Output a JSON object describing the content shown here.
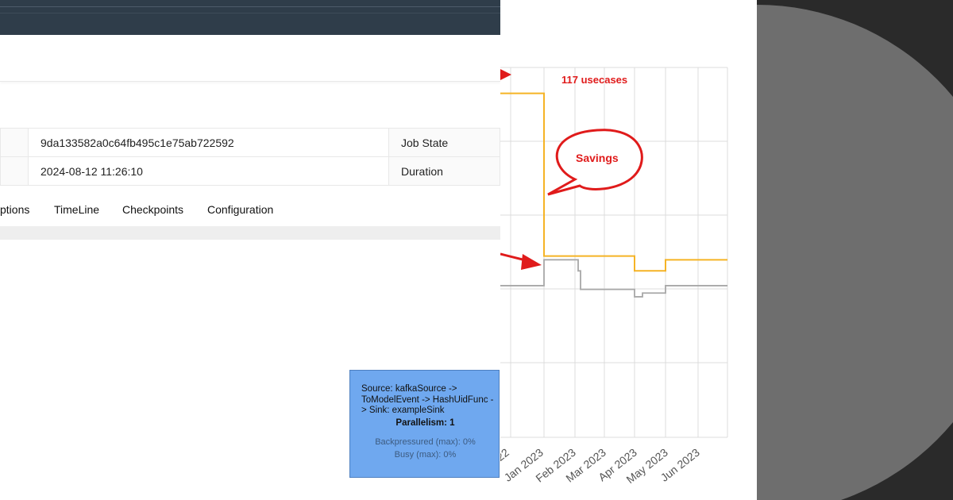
{
  "job": {
    "id": "9da133582a0c64fb495c1e75ab722592",
    "start_time": "2024-08-12 11:26:10",
    "labels": {
      "job_state": "Job State",
      "duration": "Duration"
    }
  },
  "tabs": [
    "ptions",
    "TimeLine",
    "Checkpoints",
    "Configuration"
  ],
  "node": {
    "name": "Source: kafkaSource -> ToModelEvent -> HashUidFunc -> Sink: exampleSink",
    "parallelism": "Parallelism: 1",
    "backpressured": "Backpressured (max): 0%",
    "busy": "Busy (max): 0%"
  },
  "chart_data": {
    "type": "line",
    "x_tick_labels": [
      "22",
      "Jan 2023",
      "Feb 2023",
      "Mar 2023",
      "Apr 2023",
      "May 2023",
      "Jun 2023"
    ],
    "grid": true,
    "series": [
      {
        "color": "#f5b325",
        "values_relative": [
          0.93,
          0.93,
          0.49,
          0.49,
          0.49,
          0.45,
          0.45,
          0.48,
          0.48
        ]
      },
      {
        "color": "#a8a8a8",
        "values_relative": [
          0.41,
          0.41,
          0.48,
          0.45,
          0.4,
          0.38,
          0.39,
          0.41,
          0.41
        ]
      }
    ],
    "annotations": {
      "usecases": "117 usecases",
      "savings": "Savings"
    },
    "accent_red": "#e01b1b"
  },
  "colors": {
    "topbar": "#2f3d4a",
    "node_box": "#6fa8ef",
    "deco_background": "#2a2a2a",
    "deco_circle": "#6e6e6e"
  }
}
